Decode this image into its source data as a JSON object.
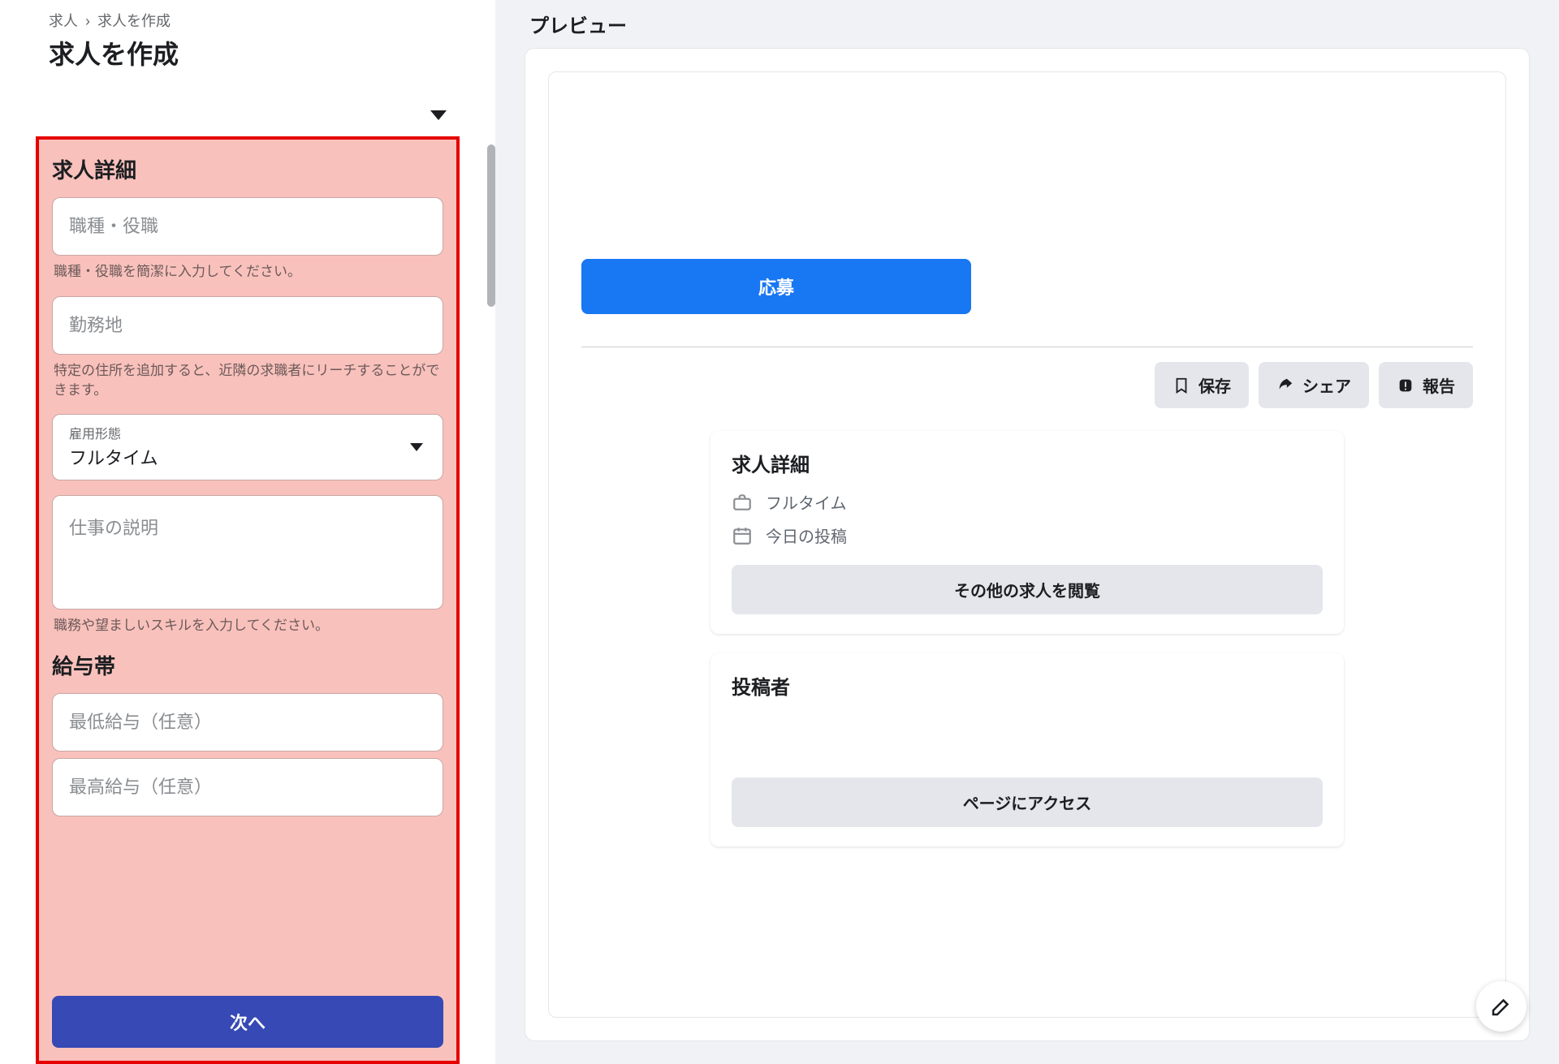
{
  "breadcrumb": {
    "root": "求人",
    "current": "求人を作成"
  },
  "page_title": "求人を作成",
  "form": {
    "details_title": "求人詳細",
    "job_title": {
      "placeholder": "職種・役職",
      "helper": "職種・役職を簡潔に入力してください。"
    },
    "location": {
      "placeholder": "勤務地",
      "helper": "特定の住所を追加すると、近隣の求職者にリーチすることができます。"
    },
    "employment_type": {
      "label": "雇用形態",
      "value": "フルタイム"
    },
    "description": {
      "placeholder": "仕事の説明",
      "helper": "職務や望ましいスキルを入力してください。"
    },
    "salary_title": "給与帯",
    "min_salary": {
      "placeholder": "最低給与（任意）"
    },
    "max_salary": {
      "placeholder": "最高給与（任意）"
    },
    "next_button": "次へ"
  },
  "preview": {
    "title": "プレビュー",
    "apply": "応募",
    "actions": {
      "save": "保存",
      "share": "シェア",
      "report": "報告"
    },
    "details_card": {
      "title": "求人詳細",
      "employment": "フルタイム",
      "posted": "今日の投稿",
      "browse_more": "その他の求人を閲覧"
    },
    "poster_card": {
      "title": "投稿者",
      "access_page": "ページにアクセス"
    }
  }
}
